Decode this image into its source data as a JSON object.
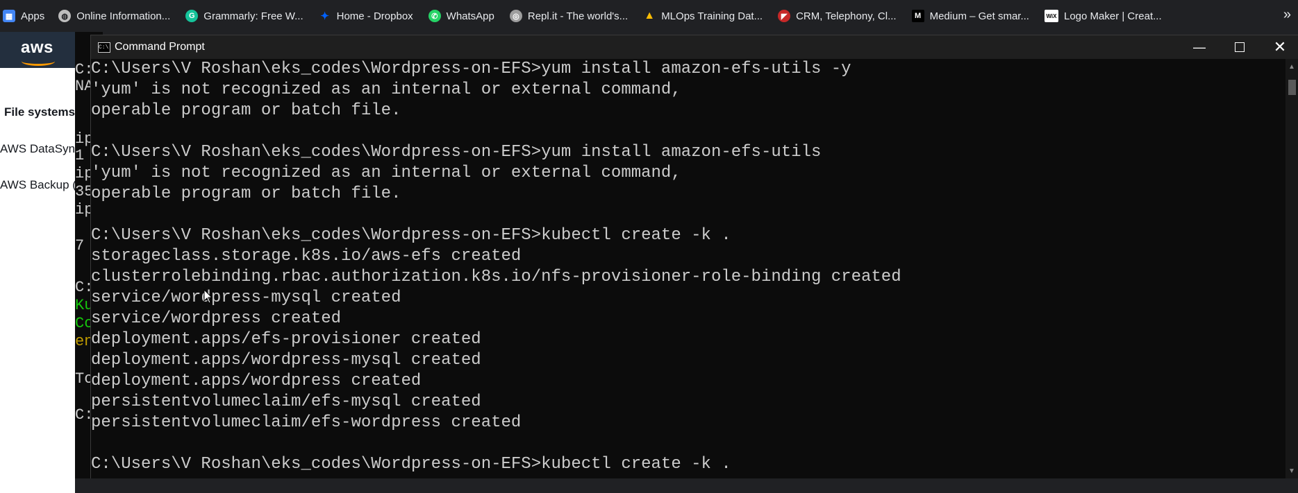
{
  "bookmarks": {
    "items": [
      {
        "label": "Apps",
        "icon": "apps-grid-icon",
        "color": "#4285f4"
      },
      {
        "label": "Online Information...",
        "icon": "globe-icon",
        "color": "#bdbdbd"
      },
      {
        "label": "Grammarly: Free W...",
        "icon": "grammarly-icon",
        "color": "#15c39a"
      },
      {
        "label": "Home - Dropbox",
        "icon": "dropbox-icon",
        "color": "#0061ff"
      },
      {
        "label": "WhatsApp",
        "icon": "whatsapp-icon",
        "color": "#25d366"
      },
      {
        "label": "Repl.it - The world's...",
        "icon": "replit-icon",
        "color": "#9e9e9e"
      },
      {
        "label": "MLOps Training Dat...",
        "icon": "google-drive-icon",
        "color": "#fbbc04"
      },
      {
        "label": "CRM, Telephony, Cl...",
        "icon": "crm-icon",
        "color": "#c62828"
      },
      {
        "label": "Medium – Get smar...",
        "icon": "medium-icon",
        "color": "#000000"
      },
      {
        "label": "Logo Maker | Creat...",
        "icon": "wix-icon",
        "color": "#ffffff"
      }
    ],
    "more": "»"
  },
  "aws": {
    "logo": "aws",
    "sidebar": [
      "File systems",
      "AWS DataSyn",
      "AWS Backup ("
    ]
  },
  "bg_terminal": [
    "C:",
    "NA",
    "ip",
    "1",
    "ip",
    "35",
    "ip",
    "7",
    "C:",
    "Ku",
    "Co",
    "en",
    "To",
    "C:"
  ],
  "window": {
    "title": "Command Prompt",
    "minimize": "—",
    "close": "✕"
  },
  "console": {
    "lines": [
      "C:\\Users\\V Roshan\\eks_codes\\Wordpress-on-EFS>yum install amazon-efs-utils -y",
      "'yum' is not recognized as an internal or external command,",
      "operable program or batch file.",
      "",
      "C:\\Users\\V Roshan\\eks_codes\\Wordpress-on-EFS>yum install amazon-efs-utils",
      "'yum' is not recognized as an internal or external command,",
      "operable program or batch file.",
      "",
      "C:\\Users\\V Roshan\\eks_codes\\Wordpress-on-EFS>kubectl create -k .",
      "storageclass.storage.k8s.io/aws-efs created",
      "clusterrolebinding.rbac.authorization.k8s.io/nfs-provisioner-role-binding created",
      "service/wordpress-mysql created",
      "service/wordpress created",
      "deployment.apps/efs-provisioner created",
      "deployment.apps/wordpress-mysql created",
      "deployment.apps/wordpress created",
      "persistentvolumeclaim/efs-mysql created",
      "persistentvolumeclaim/efs-wordpress created",
      "",
      "C:\\Users\\V Roshan\\eks_codes\\Wordpress-on-EFS>kubectl create -k ."
    ]
  }
}
